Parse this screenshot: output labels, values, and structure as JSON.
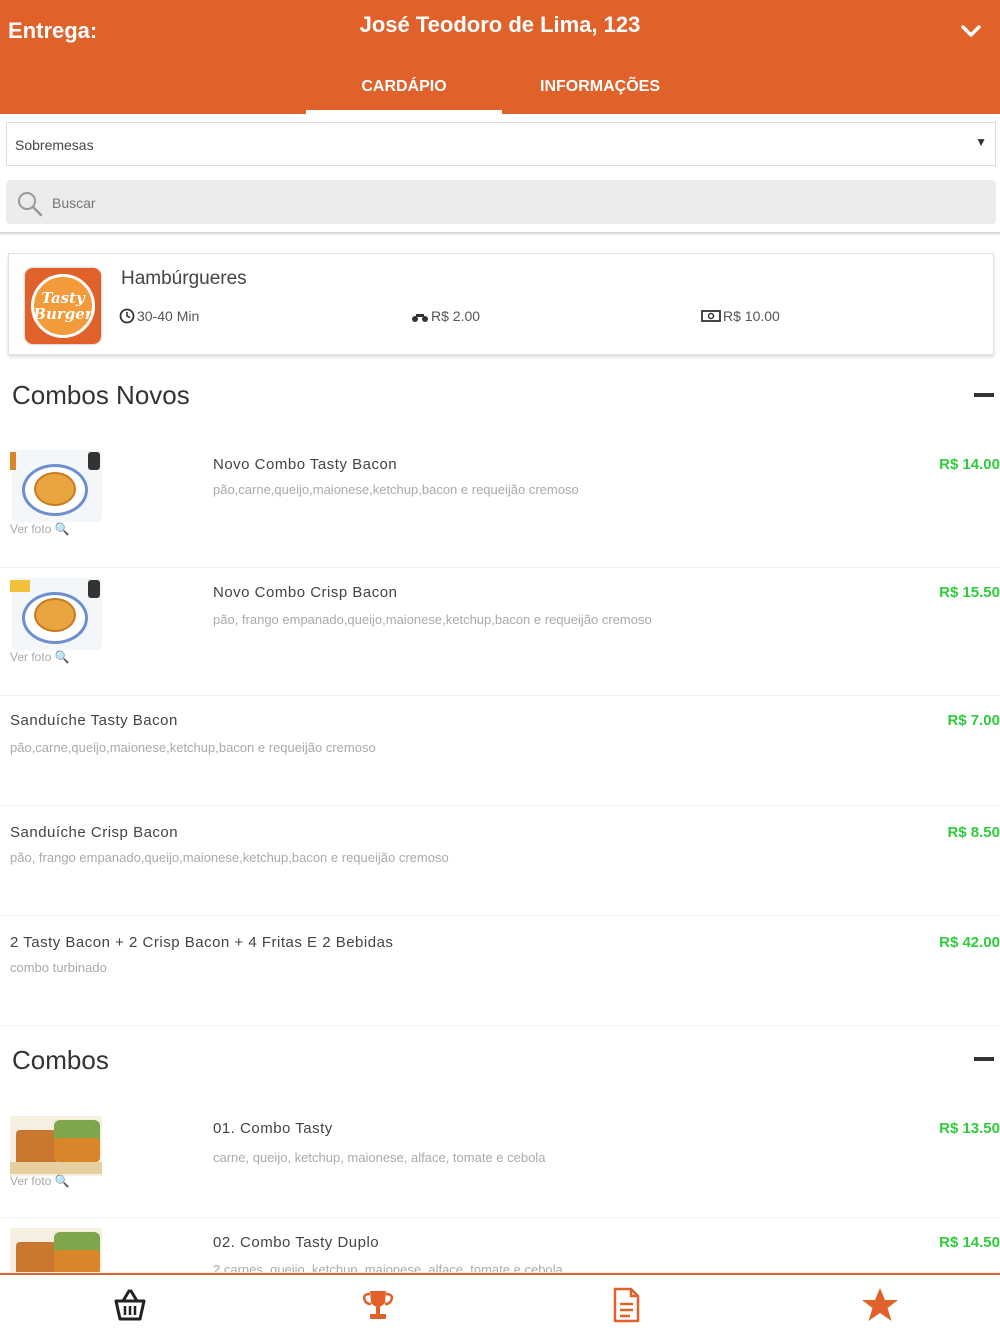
{
  "header": {
    "delivery_label": "Entrega:",
    "address": "José Teodoro de Lima, 123",
    "tabs": [
      {
        "label": "CARDÁPIO",
        "active": true
      },
      {
        "label": "INFORMAÇÕES",
        "active": false
      }
    ],
    "accent_color": "#e0612a"
  },
  "filter": {
    "category_selected": "Sobremesas",
    "search_placeholder": "Buscar"
  },
  "store": {
    "logo_text_line1": "Tasty",
    "logo_text_line2": "Burger",
    "name": "Hambúrgueres",
    "delivery_time": "30-40 Min",
    "delivery_fee": "R$ 2.00",
    "min_order": "R$ 10.00"
  },
  "sections": [
    {
      "title": "Combos Novos",
      "items": [
        {
          "title": "Novo Combo Tasty Bacon",
          "desc": "pão,carne,queijo,maionese,ketchup,bacon e requeijão cremoso",
          "price": "R$ 14.00",
          "photo_link": "Ver foto"
        },
        {
          "title": "Novo Combo Crisp Bacon",
          "desc": "pão, frango empanado,queijo,maionese,ketchup,bacon e requeijão cremoso",
          "price": "R$ 15.50",
          "photo_link": "Ver foto"
        },
        {
          "title": "Sanduíche Tasty Bacon",
          "desc": "pão,carne,queijo,maionese,ketchup,bacon e requeijão cremoso",
          "price": "R$ 7.00"
        },
        {
          "title": "Sanduíche Crisp Bacon",
          "desc": "pão, frango empanado,queijo,maionese,ketchup,bacon e requeijão cremoso",
          "price": "R$ 8.50"
        },
        {
          "title": "2 Tasty Bacon + 2 Crisp Bacon + 4 Fritas E 2 Bebidas",
          "desc": "combo turbinado",
          "price": "R$ 42.00"
        }
      ]
    },
    {
      "title": "Combos",
      "items": [
        {
          "title": "01. Combo Tasty",
          "desc": "carne, queijo, ketchup, maionese, alface, tomate e cebola",
          "price": "R$ 13.50",
          "photo_link": "Ver foto"
        },
        {
          "title": "02. Combo Tasty Duplo",
          "desc": "2 carnes, queijo, ketchup, maionese, alface, tomate e cebola",
          "price": "R$ 14.50"
        }
      ]
    }
  ],
  "bottom_nav": [
    {
      "icon": "basket-icon",
      "color": "#222222"
    },
    {
      "icon": "trophy-icon",
      "color": "#e0612a"
    },
    {
      "icon": "document-icon",
      "color": "#e0612a"
    },
    {
      "icon": "star-icon",
      "color": "#e0612a"
    }
  ],
  "price_color": "#2fcc3c"
}
